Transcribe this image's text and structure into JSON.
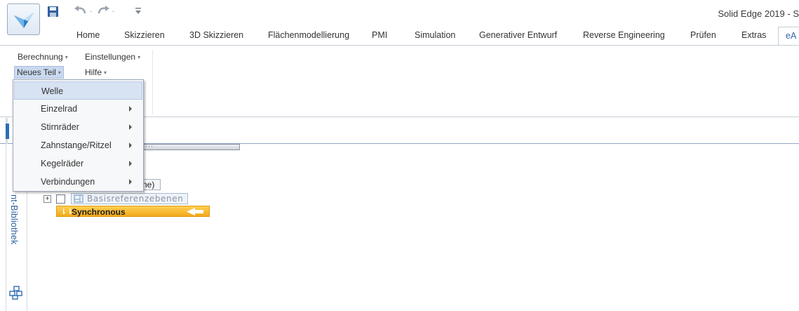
{
  "window": {
    "title": "Solid Edge 2019 - S"
  },
  "quick_access": {
    "app_icon": "solid-edge-logo-icon",
    "save_icon": "save-icon",
    "undo_icon": "undo-icon",
    "redo_icon": "redo-icon",
    "customize_icon": "customize-quick-access-icon"
  },
  "tabs": [
    {
      "label": "Home",
      "active": false
    },
    {
      "label": "Skizzieren",
      "active": false
    },
    {
      "label": "3D Skizzieren",
      "active": false
    },
    {
      "label": "Flächenmodellierung",
      "active": false
    },
    {
      "label": "PMI",
      "active": false
    },
    {
      "label": "Simulation",
      "active": false
    },
    {
      "label": "Generativer Entwurf",
      "active": false
    },
    {
      "label": "Reverse Engineering",
      "active": false
    },
    {
      "label": "Prüfen",
      "active": false
    },
    {
      "label": "Extras",
      "active": false
    },
    {
      "label": "eA",
      "active": true
    }
  ],
  "ribbon": {
    "berechnung": "Berechnung",
    "einstellungen": "Einstellungen",
    "neues_teil": "Neues Teil",
    "hilfe": "Hilfe"
  },
  "menu": {
    "items": [
      {
        "label": "Welle",
        "submenu": false,
        "highlighted": true
      },
      {
        "label": "Einzelrad",
        "submenu": true,
        "highlighted": false
      },
      {
        "label": "Stirnräder",
        "submenu": true,
        "highlighted": false
      },
      {
        "label": "Zahnstange/Ritzel",
        "submenu": true,
        "highlighted": false
      },
      {
        "label": "Kegelräder",
        "submenu": true,
        "highlighted": false
      },
      {
        "label": "Verbindungen",
        "submenu": true,
        "highlighted": false
      }
    ]
  },
  "sidebar": {
    "vertical_label": "nt-Bibliothek",
    "bottom_icon": "parts-library-icon"
  },
  "tree": {
    "partial_node": "ne)",
    "base_planes": "Basisreferenzebenen",
    "base_planes_icon": "reference-planes-icon",
    "synchronous": "Synchronous",
    "synchronous_color": "#f5b329"
  }
}
